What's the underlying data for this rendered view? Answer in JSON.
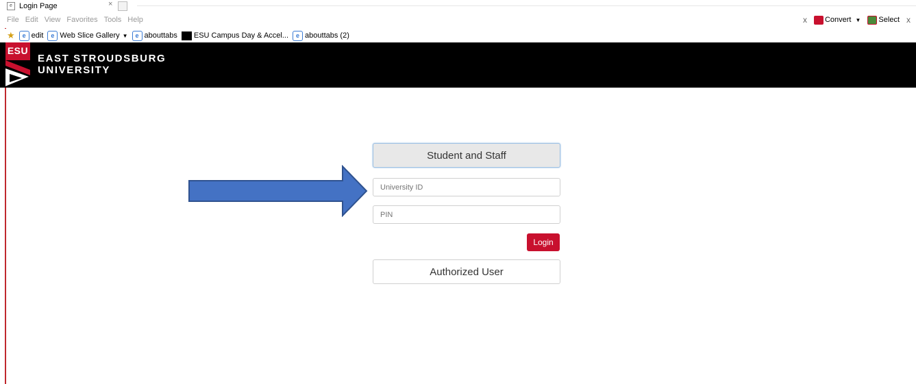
{
  "browser": {
    "tab_title": "Login Page",
    "tab_close": "×",
    "menu": [
      "File",
      "Edit",
      "View",
      "Favorites",
      "Tools",
      "Help"
    ],
    "toolbar_right": {
      "close_x": "x",
      "convert_label": "Convert",
      "select_label": "Select",
      "close_x2": "x"
    },
    "favorites": [
      "edit",
      "Web Slice Gallery",
      "abouttabs",
      "ESU Campus Day & Accel...",
      "abouttabs (2)"
    ]
  },
  "header": {
    "logo_text": "ESU",
    "university_line1": "EAST STROUDSBURG",
    "university_line2": "UNIVERSITY"
  },
  "login": {
    "student_staff_label": "Student and Staff",
    "university_id_placeholder": "University ID",
    "pin_placeholder": "PIN",
    "login_label": "Login",
    "authorized_user_label": "Authorized User"
  },
  "colors": {
    "brand_red": "#c8102e",
    "header_bg": "#000000",
    "arrow_fill": "#4472c4",
    "arrow_stroke": "#2f528f"
  },
  "icons": [
    "ie-page-icon",
    "convert-icon",
    "select-icon",
    "favorites-star-icon",
    "arrow-right-icon"
  ]
}
